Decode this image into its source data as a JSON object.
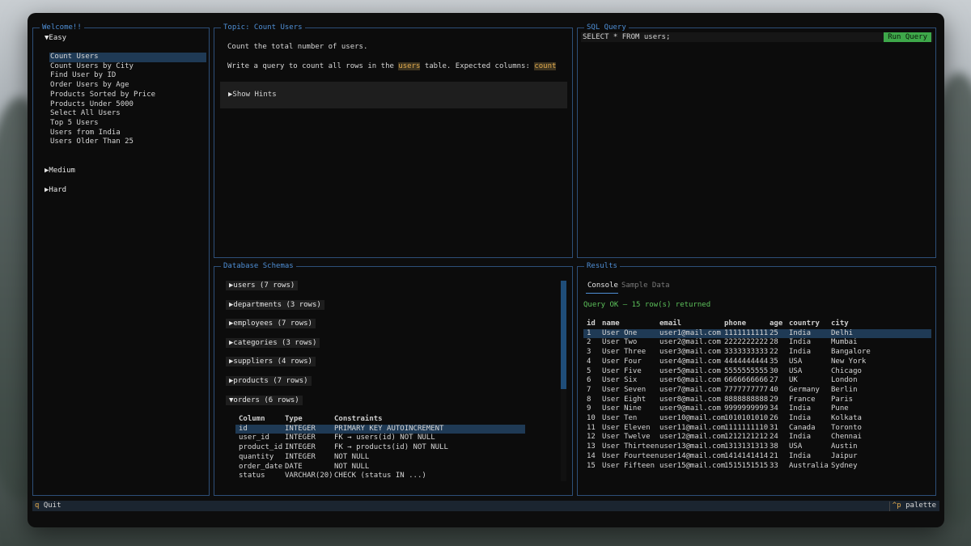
{
  "sidebar": {
    "title": "Welcome!!",
    "groups": [
      {
        "label": "Easy",
        "expanded": true
      },
      {
        "label": "Medium",
        "expanded": false
      },
      {
        "label": "Hard",
        "expanded": false
      }
    ],
    "easy_items": [
      "Count Users",
      "Count Users by City",
      "Find User by ID",
      "Order Users by Age",
      "Products Sorted by Price",
      "Products Under 5000",
      "Select All Users",
      "Top 5 Users",
      "Users from India",
      "Users Older Than 25"
    ]
  },
  "topic": {
    "title": "Topic: Count Users",
    "line1": "Count the total number of users.",
    "line2_prefix": "Write a query to count all rows in the",
    "line2_table": "users",
    "line2_mid": "table. Expected columns:",
    "line2_col": "count",
    "hints_label": "Show Hints"
  },
  "sql": {
    "title": "SQL Query",
    "query": "SELECT * FROM users;",
    "run_label": "Run Query"
  },
  "schemas": {
    "title": "Database Schemas",
    "tables": [
      "users (7 rows)",
      "departments (3 rows)",
      "employees (7 rows)",
      "categories (3 rows)",
      "suppliers (4 rows)",
      "products (7 rows)",
      "orders (6 rows)"
    ],
    "orders_headers": [
      "Column",
      "Type",
      "Constraints"
    ],
    "orders_rows": [
      [
        "id",
        "INTEGER",
        "PRIMARY KEY AUTOINCREMENT"
      ],
      [
        "user_id",
        "INTEGER",
        "FK → users(id) NOT NULL"
      ],
      [
        "product_id",
        "INTEGER",
        "FK → products(id) NOT NULL"
      ],
      [
        "quantity",
        "INTEGER",
        "NOT NULL"
      ],
      [
        "order_date",
        "DATE",
        "NOT NULL"
      ],
      [
        "status",
        "VARCHAR(20)",
        "CHECK (status IN ...)"
      ]
    ]
  },
  "results": {
    "title": "Results",
    "tabs": [
      "Console",
      "Sample Data"
    ],
    "status": "Query OK — 15 row(s) returned",
    "headers": [
      "id",
      "name",
      "email",
      "phone",
      "age",
      "country",
      "city"
    ],
    "rows": [
      [
        "1",
        "User One",
        "user1@mail.com",
        "1111111111",
        "25",
        "India",
        "Delhi"
      ],
      [
        "2",
        "User Two",
        "user2@mail.com",
        "2222222222",
        "28",
        "India",
        "Mumbai"
      ],
      [
        "3",
        "User Three",
        "user3@mail.com",
        "3333333333",
        "22",
        "India",
        "Bangalore"
      ],
      [
        "4",
        "User Four",
        "user4@mail.com",
        "4444444444",
        "35",
        "USA",
        "New York"
      ],
      [
        "5",
        "User Five",
        "user5@mail.com",
        "5555555555",
        "30",
        "USA",
        "Chicago"
      ],
      [
        "6",
        "User Six",
        "user6@mail.com",
        "6666666666",
        "27",
        "UK",
        "London"
      ],
      [
        "7",
        "User Seven",
        "user7@mail.com",
        "7777777777",
        "40",
        "Germany",
        "Berlin"
      ],
      [
        "8",
        "User Eight",
        "user8@mail.com",
        "8888888888",
        "29",
        "France",
        "Paris"
      ],
      [
        "9",
        "User Nine",
        "user9@mail.com",
        "9999999999",
        "34",
        "India",
        "Pune"
      ],
      [
        "10",
        "User Ten",
        "user10@mail.com",
        "1010101010",
        "26",
        "India",
        "Kolkata"
      ],
      [
        "11",
        "User Eleven",
        "user11@mail.com",
        "1111111110",
        "31",
        "Canada",
        "Toronto"
      ],
      [
        "12",
        "User Twelve",
        "user12@mail.com",
        "1212121212",
        "24",
        "India",
        "Chennai"
      ],
      [
        "13",
        "User Thirteen",
        "user13@mail.com",
        "1313131313",
        "38",
        "USA",
        "Austin"
      ],
      [
        "14",
        "User Fourteen",
        "user14@mail.com",
        "1414141414",
        "21",
        "India",
        "Jaipur"
      ],
      [
        "15",
        "User Fifteen",
        "user15@mail.com",
        "1515151515",
        "33",
        "Australia",
        "Sydney"
      ]
    ]
  },
  "footer": {
    "quit_key": "q",
    "quit_label": "Quit",
    "palette_key": "^p",
    "palette_label": "palette"
  },
  "colors": {
    "border": "#2d4f78",
    "title": "#4f8fd6",
    "accent_green": "#3ea84a",
    "highlight_orange": "#e1a94d",
    "selection": "#1f3a55"
  }
}
